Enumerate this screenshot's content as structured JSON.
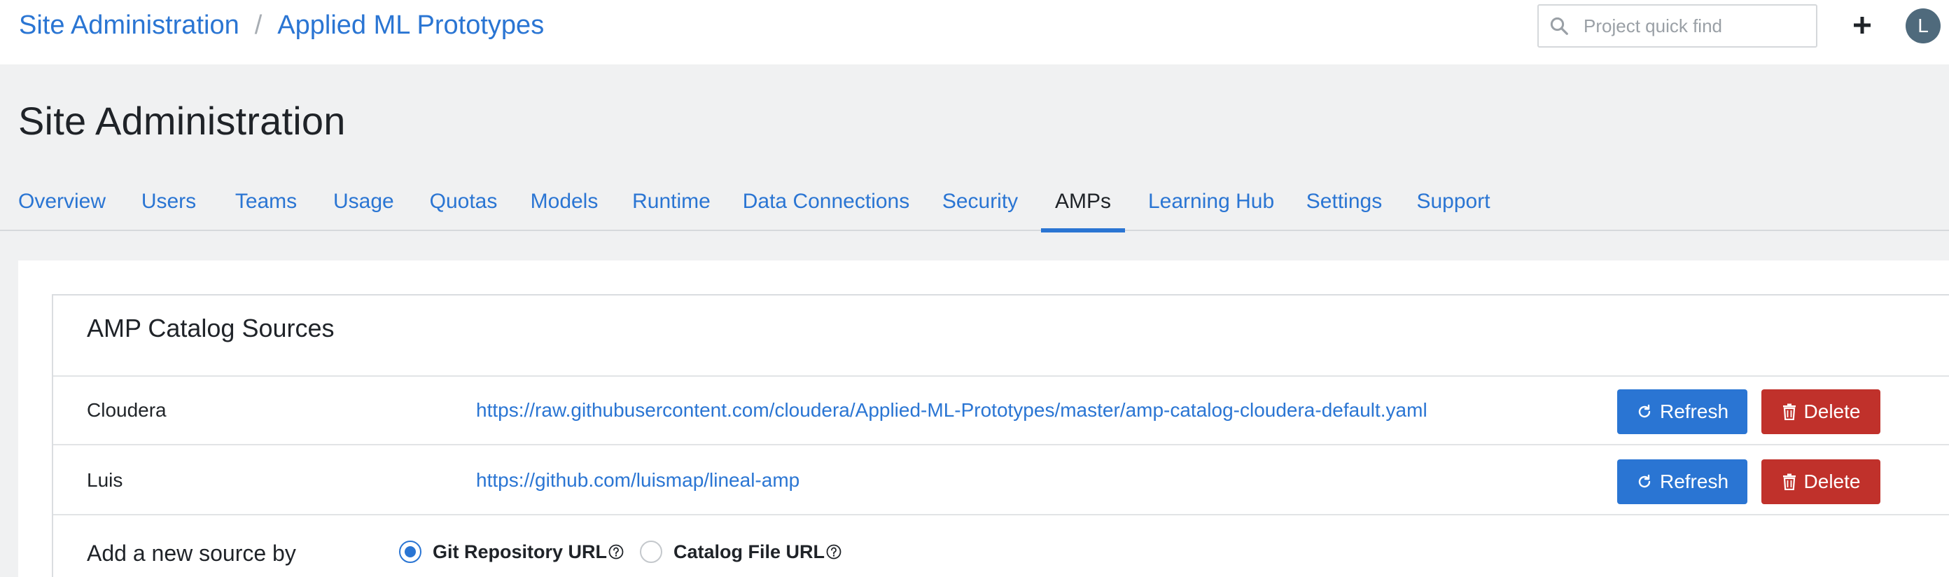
{
  "header": {
    "breadcrumb": [
      "Site Administration",
      "Applied ML Prototypes"
    ],
    "breadcrumb_separator": "/",
    "search_placeholder": "Project quick find",
    "plus_icon": "plus-icon",
    "avatar_initial": "L"
  },
  "page": {
    "title": "Site Administration",
    "active_tab": "AMPs",
    "tabs": [
      "Overview",
      "Users",
      "Teams",
      "Usage",
      "Quotas",
      "Models",
      "Runtime",
      "Data Connections",
      "Security",
      "AMPs",
      "Learning Hub",
      "Settings",
      "Support"
    ]
  },
  "catalog": {
    "title": "AMP Catalog Sources",
    "sources": [
      {
        "name": "Cloudera",
        "url": "https://raw.githubusercontent.com/cloudera/Applied-ML-Prototypes/master/amp-catalog-cloudera-default.yaml"
      },
      {
        "name": "Luis",
        "url": "https://github.com/luismap/lineal-amp"
      }
    ],
    "refresh_label": "Refresh",
    "delete_label": "Delete",
    "add_label": "Add a new source by",
    "options": [
      {
        "label": "Git Repository URL",
        "checked": true
      },
      {
        "label": "Catalog File URL",
        "checked": false
      }
    ]
  },
  "colors": {
    "accent": "#2a75d3",
    "danger": "#c0312b",
    "avatar": "#4f6a7c"
  }
}
